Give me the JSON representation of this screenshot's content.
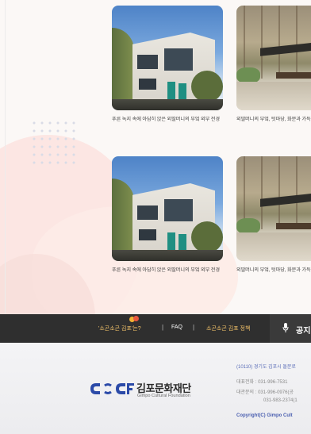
{
  "cards": [
    {
      "caption": "푸른 녹지 속에 아담히 앉은 외딸머니의 부엌 외부 전경",
      "image": "house-photo"
    },
    {
      "caption": "외딸머니의 부엌, 텃마당, 화분과 가득하다",
      "image": "forest-patio-photo"
    },
    {
      "caption": "푸른 녹지 속에 아담히 앉은 외딸머니의 부엌 외부 전경",
      "image": "house-photo"
    },
    {
      "caption": "외딸머니의 부엌, 텃마당, 화분과 가득하다",
      "image": "forest-patio-photo"
    }
  ],
  "footer_nav": {
    "about": "'소곤소곤 김포'는?",
    "sep": "|",
    "faq": "FAQ",
    "policy": "소곤소곤 김포 정책",
    "announce": "공지",
    "announce_icon": "microphone-icon",
    "badge_colors": [
      "#f2b233",
      "#e8573f"
    ]
  },
  "footer": {
    "logo_ko": "김포문화재단",
    "logo_en": "Gimpo Cultural Foundation",
    "logo_mark_color": "#2b4aa8",
    "address": "(10110) 경기도 김포시 돌문로",
    "phone": "대표전화 : 031-996-7531",
    "rental": "대관문의 : 031-996-0976(공",
    "rental2": "031-983-2374(1",
    "copyright": "Copyright(C) Gimpo Cult"
  }
}
